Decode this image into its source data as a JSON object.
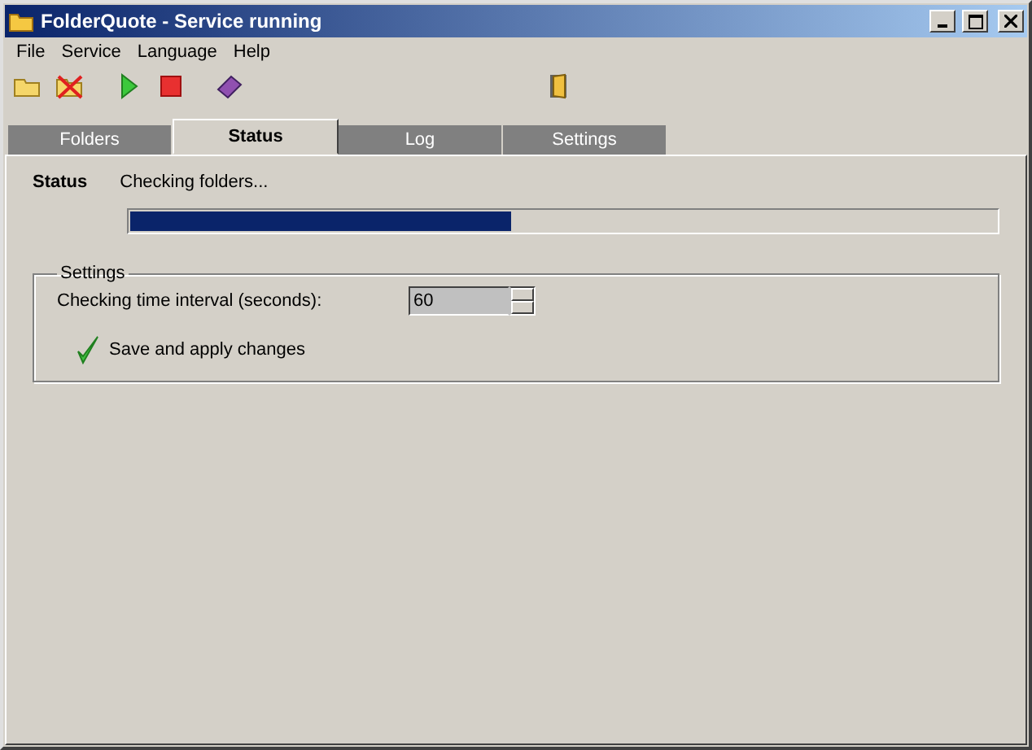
{
  "window": {
    "title": "FolderQuote - Service running"
  },
  "menu": [
    "File",
    "Service",
    "Language",
    "Help"
  ],
  "tabs": [
    {
      "label": "Folders",
      "selected": false
    },
    {
      "label": "Status",
      "selected": true
    },
    {
      "label": "Log",
      "selected": false
    },
    {
      "label": "Settings",
      "selected": false
    }
  ],
  "status": {
    "label": "Status",
    "message": "Checking folders...",
    "level": 0.44
  },
  "settings": {
    "legend": "Settings",
    "interval_label": "Checking time interval (seconds):",
    "interval_value": "60",
    "save_label": "Save and apply changes"
  }
}
